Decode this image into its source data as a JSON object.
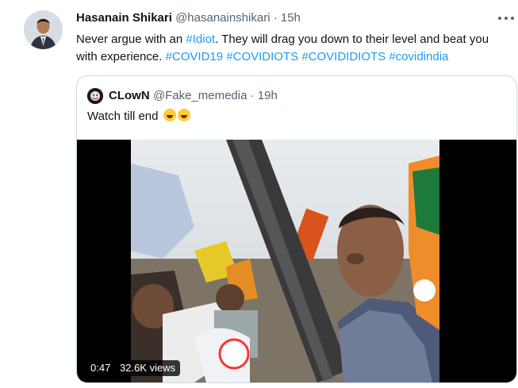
{
  "tweet": {
    "author_name": "Hasanain Shikari",
    "author_handle": "@hasanainshikari",
    "separator": "·",
    "time": "15h",
    "text_intro": "Never argue with an ",
    "hashtag_idiot": "#Idiot",
    "text_rest": ". They will drag you down to their level and beat you with experience. ",
    "hashtags": [
      "#COVID19",
      "#COVIDIOTS",
      "#COVIDIDIOTS",
      "#covidindia"
    ],
    "more_icon": "more-horizontal-icon"
  },
  "quoted": {
    "author_name": "CLowN",
    "author_handle": "@Fake_memedia",
    "separator": "·",
    "time": "19h",
    "text": "Watch till end",
    "emoji": "face-with-tears-of-joy",
    "video": {
      "duration": "0:47",
      "views": "32.6K views"
    }
  },
  "colors": {
    "link": "#1d9bf0",
    "secondary_text": "#536471",
    "border": "#cfd9de"
  }
}
